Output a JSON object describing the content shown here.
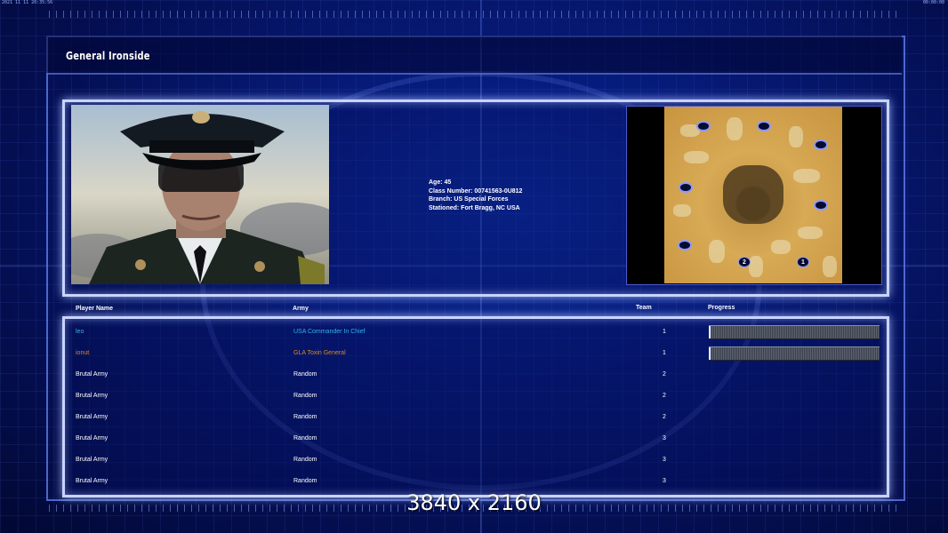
{
  "status_bar": {
    "left": "2021 11 11 20:35:56",
    "right": "00:00:00"
  },
  "general": {
    "name": "General Ironside",
    "age": "Age: 45",
    "class_number": "Class Number: 00741563-0U812",
    "branch": "Branch: US Special Forces",
    "stationed": "Stationed: Fort Bragg, NC USA"
  },
  "minimap": {
    "start_numbers": [
      "2",
      "1"
    ]
  },
  "columns": {
    "player_name": "Player Name",
    "army": "Army",
    "team": "Team",
    "progress": "Progress"
  },
  "players": [
    {
      "name": "leo",
      "army": "USA Commander In Chief",
      "team": "1",
      "color": "#2fb6e8",
      "progress": 0.01,
      "show_progress": true
    },
    {
      "name": "ionut",
      "army": "GLA Toxin General",
      "team": "1",
      "color": "#d98a1e",
      "progress": 0.0,
      "show_progress": true
    },
    {
      "name": "Brutal Army",
      "army": "Random",
      "team": "2",
      "color": "#ffffff"
    },
    {
      "name": "Brutal Army",
      "army": "Random",
      "team": "2",
      "color": "#ffffff"
    },
    {
      "name": "Brutal Army",
      "army": "Random",
      "team": "2",
      "color": "#ffffff"
    },
    {
      "name": "Brutal Army",
      "army": "Random",
      "team": "3",
      "color": "#ffffff"
    },
    {
      "name": "Brutal Army",
      "army": "Random",
      "team": "3",
      "color": "#ffffff"
    },
    {
      "name": "Brutal Army",
      "army": "Random",
      "team": "3",
      "color": "#ffffff"
    }
  ],
  "overlay_text": "3840 x 2160"
}
